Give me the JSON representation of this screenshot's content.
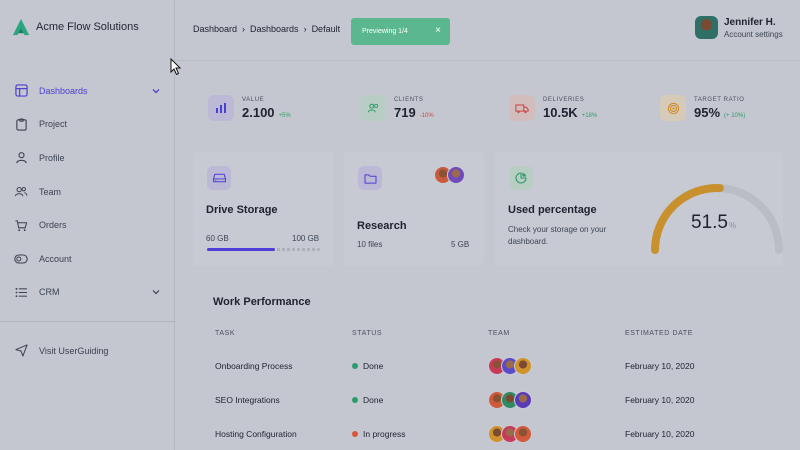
{
  "brand": {
    "name": "Acme Flow Solutions",
    "color": "#2aa683"
  },
  "breadcrumb": [
    "Dashboard",
    "Dashboards",
    "Default"
  ],
  "toast": {
    "text": "Previewing 1/4",
    "close": "×",
    "color": "#5bb88e"
  },
  "user": {
    "name": "Jennifer H.",
    "subtitle": "Account settings"
  },
  "sidebar": {
    "items": [
      {
        "label": "Dashboards",
        "icon": "layout-icon",
        "active": true,
        "expandable": true
      },
      {
        "label": "Project",
        "icon": "clipboard-icon"
      },
      {
        "label": "Profile",
        "icon": "user-icon"
      },
      {
        "label": "Team",
        "icon": "users-icon"
      },
      {
        "label": "Orders",
        "icon": "cart-icon"
      },
      {
        "label": "Account",
        "icon": "toggle-icon"
      },
      {
        "label": "CRM",
        "icon": "list-icon",
        "expandable": true
      }
    ],
    "footer": {
      "label": "Visit UserGuiding",
      "icon": "send-icon"
    },
    "accent": "#4b3fd1"
  },
  "stats": [
    {
      "label": "VALUE",
      "value": "2.100",
      "delta": "+5%",
      "delta_color": "#2e9b6a",
      "icon": "chart-icon"
    },
    {
      "label": "CLIENTS",
      "value": "719",
      "delta": "-10%",
      "delta_color": "#d04848",
      "icon": "users-icon"
    },
    {
      "label": "DELIVERIES",
      "value": "10.5K",
      "delta": "+18%",
      "delta_color": "#2e9b6a",
      "icon": "truck-icon"
    },
    {
      "label": "TARGET RATIO",
      "value": "95%",
      "delta": "(+ 10%)",
      "delta_color": "#2e9b6a",
      "icon": "target-icon"
    }
  ],
  "cards": {
    "drive": {
      "title": "Drive Storage",
      "used": "60 GB",
      "total": "100 GB",
      "fraction": 0.6
    },
    "research": {
      "title": "Research",
      "files": "10 files",
      "size": "5 GB"
    },
    "usage": {
      "title": "Used percentage",
      "text": "Check your storage on your dashboard.",
      "value": "51.5",
      "unit": "%",
      "fraction": 0.515
    }
  },
  "table": {
    "title": "Work Performance",
    "columns": [
      "TASK",
      "STATUS",
      "TEAM",
      "ESTIMATED DATE"
    ],
    "rows": [
      {
        "task": "Onboarding Process",
        "status": "Done",
        "status_color": "#2e9b6a",
        "date": "February 10, 2020"
      },
      {
        "task": "SEO Integrations",
        "status": "Done",
        "status_color": "#2e9b6a",
        "date": "February 10, 2020"
      },
      {
        "task": "Hosting Configuration",
        "status": "In progress",
        "status_color": "#d9563a",
        "date": "February 10, 2020"
      }
    ]
  }
}
